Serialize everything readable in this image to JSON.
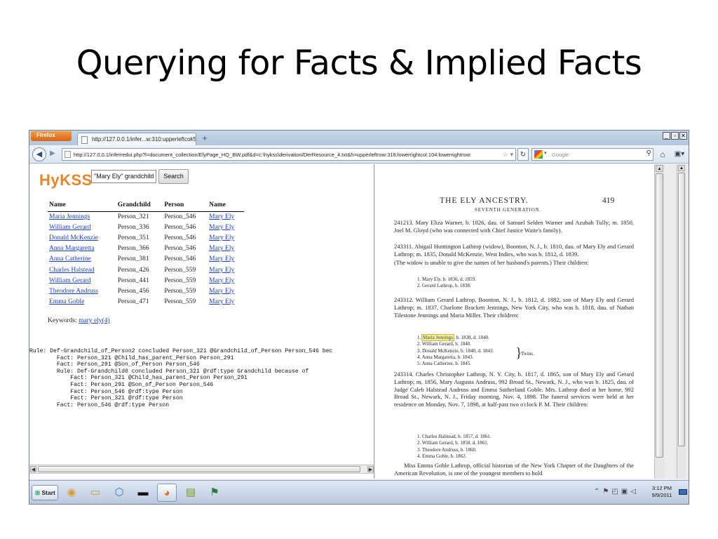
{
  "slide": {
    "title": "Querying for Facts & Implied Facts"
  },
  "browser": {
    "firefox_label": "Firefox",
    "tab_title": "http://127.0.0.1/infer...w:310:upperleftcol:55",
    "tab_close": "×",
    "new_tab": "+",
    "url": "http://127.0.0.1/inferredui.php?l=document_collection/ElyPage_HQ_BW.pdf&d=c:\\hykss\\derivation/DerResource_4.txt&h=upperleftrow:316:lowerrightcol:104:lowerrightrow:",
    "url_tail": "☆ ▾",
    "search_placeholder": "Google",
    "window_controls": [
      "_",
      "▫",
      "✕"
    ]
  },
  "app": {
    "logo": "HyKSS",
    "query_value": "\"Mary Ely\" grandchild",
    "search_button": "Search",
    "columns": [
      "Name",
      "Grandchild",
      "Person",
      "Name"
    ],
    "rows": [
      [
        "Maria Jennings",
        "Person_321",
        "Person_546",
        "Mary Ely"
      ],
      [
        "William Gerard",
        "Person_336",
        "Person_546",
        "Mary Ely"
      ],
      [
        "Donald McKenzie",
        "Person_351",
        "Person_546",
        "Mary Ely"
      ],
      [
        "Anna Margaretta",
        "Person_366",
        "Person_546",
        "Mary Ely"
      ],
      [
        "Anna Catherine",
        "Person_381",
        "Person_546",
        "Mary Ely"
      ],
      [
        "Charles Halstead",
        "Person_426",
        "Person_559",
        "Mary Ely"
      ],
      [
        "William Gerard",
        "Person_441",
        "Person_559",
        "Mary Ely"
      ],
      [
        "Theodore Andruss",
        "Person_456",
        "Person_559",
        "Mary Ely"
      ],
      [
        "Emma Goble",
        "Person_471",
        "Person_559",
        "Mary Ely"
      ]
    ],
    "keywords_label": "Keywords:",
    "keywords_link": "mary ely(4)",
    "rule_lines": [
      "Rule: Def-Grandchild_of_Person2 concluded Person_321 @Grandchild_of_Person Person_546 bec",
      "        Fact: Person_321 @Child_has_parent_Person Person_291",
      "        Fact: Person_291 @Son_of_Person Person_546",
      "        Rule: Def-Grandchild0 concluded Person_321 @rdf:type Grandchild because of",
      "            Fact: Person_321 @Child_has_parent_Person Person_291",
      "            Fact: Person_291 @Son_of_Person Person_546",
      "            Fact: Person_546 @rdf:type Person",
      "            Fact: Person_321 @rdf:type Person",
      "        Fact: Person_546 @rdf:type Person"
    ]
  },
  "document": {
    "header": "THE ELY ANCESTRY.",
    "page_number": "419",
    "subheader": "SEVENTH GENERATION.",
    "para1": "241213. Mary Eliza Warner, b. 1826, dau. of Samuel Selden Warner and Azubah Tully; m. 1850, Joel M. Gloyd (who was connected with Chief Justice Waite's family).",
    "para2": "243311. Abigail Huntington Lathrop (widow), Boonton, N. J., b. 1810, dau. of Mary Ely and Gerard Lathrop; m. 1835, Donald McKenzie, West Indies, who was b. 1812, d. 1839.",
    "para2b": "(The widow is unable to give the names of her husband's parents.) Their children:",
    "list1": [
      "1. Mary Ely, b. 1836, d. 1859.",
      "2. Gerard Lathrop, b. 1838."
    ],
    "para3": "243312. William Gerard Lathrop, Boonton, N. J., b. 1812, d. 1882, son of Mary Ely and Gerard Lathrop; m. 1837, Charlotte Brackett Jennings, New York City, who was b. 1818, dau. of Nathan Tilestone Jennings and Maria Miller. Their children:",
    "list2_highlight": "Maria Jennings",
    "list2_first_prefix": "1. ",
    "list2_first_suffix": ", b. 1838, d. 1840.",
    "list2": [
      "2. William Gerard, b. 1840.",
      "3. Donald McKenzie, b. 1840, d. 1843.",
      "4. Anna Margaretta, b. 1843.",
      "5. Anna Catherine, b. 1845."
    ],
    "twins_label": "Twins.",
    "para4": "243314. Charles Christopher Lathrop, N. Y. City, b. 1817, d. 1865, son of Mary Ely and Gerard Lathrop; m. 1856, Mary Augusta Andruss, 992 Broad St., Newark, N. J., who was b. 1825, dau. of Judge Caleb Halstead Andruss and Emma Sutherland Goble. Mrs. Lathrop died at her home, 992 Broad St., Newark, N. J., Friday morning, Nov. 4, 1898. The funeral services were held at her residence on Monday, Nov. 7, 1898, at half-past two o'clock P. M. Their children:",
    "list3": [
      "1. Charles Halstead, b. 1857, d. 1861.",
      "2. William Gerard, b. 1858, d. 1861.",
      "3. Theodore Andruss, b. 1860.",
      "4. Emma Goble, b. 1862."
    ],
    "para5": "Miss Emma Goble Lathrop, official historian of the New York Chapter of the Daughters of the American Revolution, is one of the youngest members to hold"
  },
  "taskbar": {
    "start_label": "Start",
    "time": "3:12 PM",
    "date": "9/9/2011"
  }
}
